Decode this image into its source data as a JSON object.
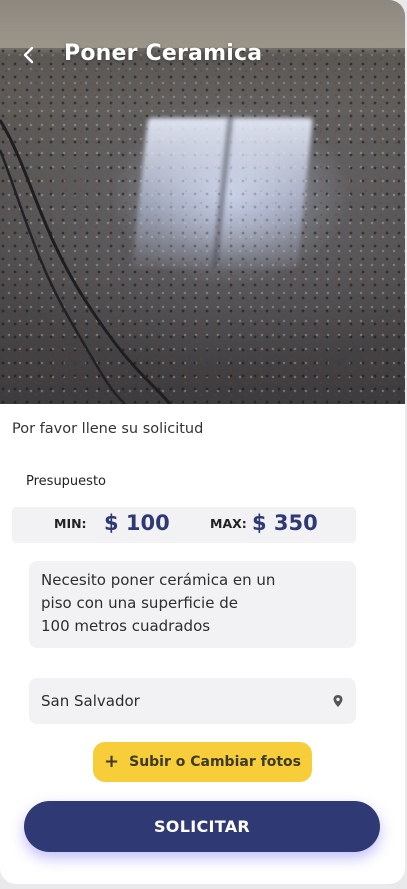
{
  "header": {
    "title": "Poner Ceramica",
    "back_icon": "chevron-left-icon"
  },
  "form": {
    "intro": "Por favor llene su solicitud",
    "budget": {
      "label": "Presupuesto",
      "min_label": "MIN:",
      "min_value": "$ 100",
      "max_label": "MAX:",
      "max_value": "$ 350"
    },
    "description_lines": [
      "Necesito poner cerámica en un",
      "piso con una superficie de",
      "100 metros cuadrados"
    ],
    "location": {
      "value": "San Salvador",
      "icon": "location-pin-icon"
    },
    "photo_button": {
      "icon": "plus-icon",
      "label": "Subir o Cambiar fotos"
    },
    "submit_label": "SOLICITAR"
  },
  "colors": {
    "primary": "#2f3a74",
    "accent_yellow": "#f7ce3a",
    "field_bg": "#f2f2f4",
    "shadow_purple": "#786ef0"
  }
}
